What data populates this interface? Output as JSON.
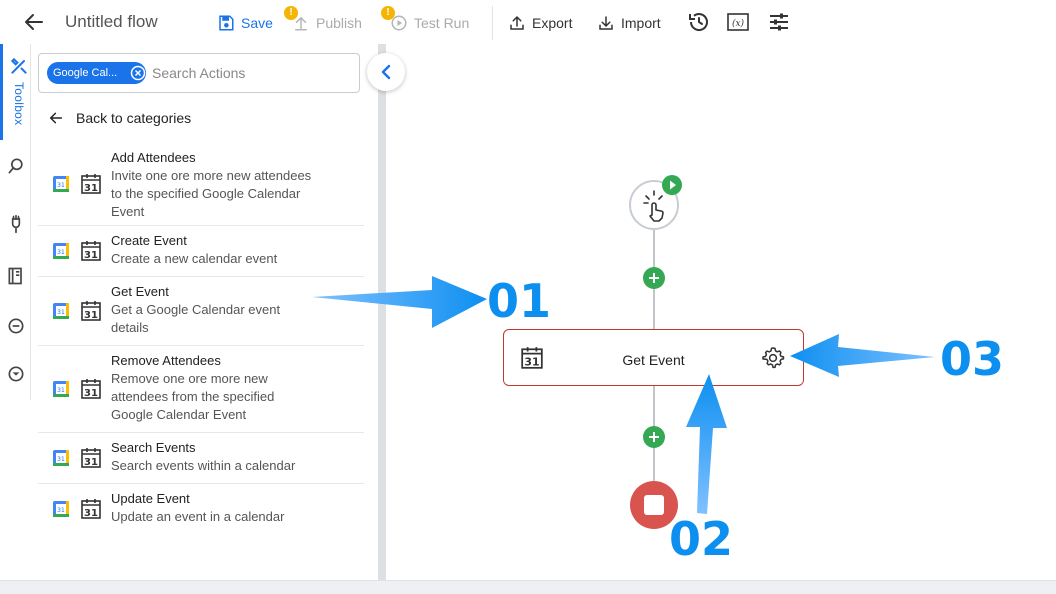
{
  "header": {
    "title": "Untitled flow",
    "save_label": "Save",
    "publish_label": "Publish",
    "publish_warning": "!",
    "testrun_label": "Test Run",
    "testrun_warning": "!",
    "export_label": "Export",
    "import_label": "Import"
  },
  "rail": {
    "toolbox_label": "Toolbox"
  },
  "search": {
    "chip_label": "Google Cal...",
    "placeholder": "Search Actions"
  },
  "panel": {
    "back_label": "Back to categories",
    "actions": [
      {
        "title": "Add Attendees",
        "lines": [
          "Invite one ore more new attendees",
          "to the specified Google Calendar",
          "Event"
        ]
      },
      {
        "title": "Create Event",
        "lines": [
          "Create a new calendar event"
        ]
      },
      {
        "title": "Get Event",
        "lines": [
          "Get a Google Calendar event",
          "details"
        ]
      },
      {
        "title": "Remove Attendees",
        "lines": [
          "Remove one ore more new",
          "attendees from the specified",
          "Google Calendar Event"
        ]
      },
      {
        "title": "Search Events",
        "lines": [
          "Search events within a calendar"
        ]
      },
      {
        "title": "Update Event",
        "lines": [
          "Update an event in a calendar"
        ]
      }
    ]
  },
  "canvas": {
    "step_label": "Get Event"
  },
  "annotations": {
    "a1": "01",
    "a2": "02",
    "a3": "03"
  },
  "colors": {
    "accent": "#1a73e8",
    "add_node": "#34a853",
    "stop_node": "#d9534f",
    "step_border": "#c0392b",
    "annotation": "#0d8ff0"
  }
}
